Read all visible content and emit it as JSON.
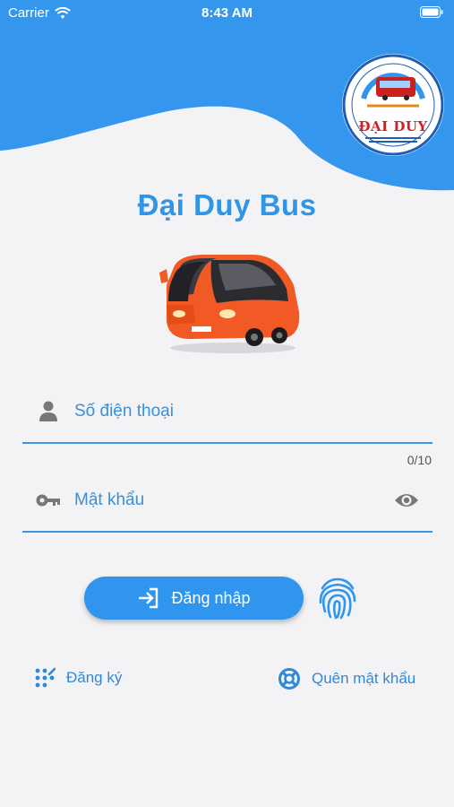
{
  "status_bar": {
    "carrier": "Carrier",
    "time": "8:43 AM"
  },
  "logo": {
    "text": "ĐẠI DUY"
  },
  "app_title": "Đại Duy Bus",
  "form": {
    "phone_placeholder": "Số điện thoại",
    "phone_counter": "0/10",
    "password_placeholder": "Mật khẩu"
  },
  "actions": {
    "login_label": "Đăng nhập",
    "register_label": "Đăng ký",
    "forgot_label": "Quên mật khẩu"
  },
  "icons": {
    "phone_field": "person-icon",
    "password_field": "key-icon",
    "password_toggle": "eye-icon",
    "login": "login-arrow-icon",
    "biometric": "fingerprint-icon",
    "register": "dots-grid-icon",
    "forgot": "lifebuoy-icon"
  },
  "colors": {
    "primary": "#2f95ee",
    "title": "#2f95e6",
    "background": "#f3f3f6",
    "logo_red": "#d42020"
  }
}
